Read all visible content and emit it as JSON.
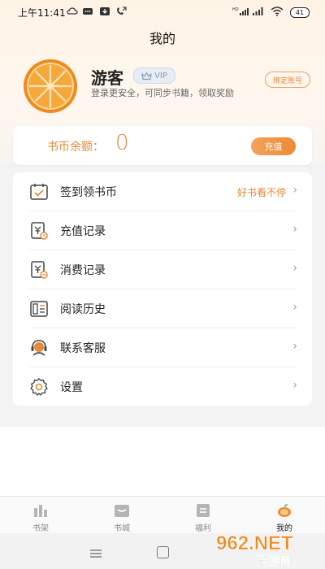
{
  "status_bar": {
    "time": "上午11:41",
    "battery": "41"
  },
  "header": {
    "title": "我的"
  },
  "profile": {
    "username": "游客",
    "vip_label": "VIP",
    "subtitle": "登录更安全，可同步书籍，领取奖励",
    "bind_label": "绑定账号"
  },
  "balance": {
    "label": "书币余额：",
    "value": "0",
    "recharge_label": "充值"
  },
  "menu": {
    "items": [
      {
        "label": "签到领书币",
        "extra": "好书看不停",
        "icon": "calendar-check-icon"
      },
      {
        "label": "充值记录",
        "icon": "recharge-record-icon"
      },
      {
        "label": "消费记录",
        "icon": "consume-record-icon"
      },
      {
        "label": "阅读历史",
        "icon": "reading-history-icon"
      },
      {
        "label": "联系客服",
        "icon": "customer-service-icon"
      },
      {
        "label": "设置",
        "icon": "gear-icon"
      }
    ]
  },
  "tabs": [
    {
      "label": "书架",
      "icon": "bookshelf-icon"
    },
    {
      "label": "书城",
      "icon": "bookstore-icon"
    },
    {
      "label": "福利",
      "icon": "welfare-icon"
    },
    {
      "label": "我的",
      "icon": "profile-icon",
      "active": true
    }
  ],
  "watermark": {
    "text": "962.NET",
    "subtext": "乐游网"
  },
  "colors": {
    "accent": "#e8883a",
    "text": "#222222",
    "muted": "#8a8a8a"
  }
}
